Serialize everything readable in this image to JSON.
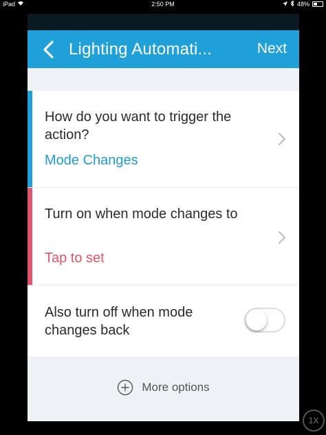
{
  "status": {
    "device": "iPad",
    "wifi_icon": "wifi-icon",
    "time": "2:50 PM",
    "battery": "48%",
    "battery_level": 48
  },
  "nav": {
    "title": "Lighting Automati...",
    "next_label": "Next",
    "back_icon": "chevron-left-icon"
  },
  "rows": [
    {
      "question": "How do you want to trigger the action?",
      "answer": "Mode Changes",
      "accent": "#1fa0d8",
      "answer_color": "#1f9cc9"
    },
    {
      "question": "Turn on when mode changes to",
      "answer": "Tap to set",
      "accent": "#e0566a",
      "answer_color": "#e0566a"
    },
    {
      "label": "Also turn off when mode changes back",
      "toggle_on": false
    }
  ],
  "more_options": {
    "label": "More options",
    "icon": "plus-circle-icon"
  },
  "zoom_button": {
    "label": "1X"
  },
  "colors": {
    "nav_background": "#1fa0d8",
    "page_background": "#eef1f5",
    "top_strip": "#0b1a22"
  }
}
